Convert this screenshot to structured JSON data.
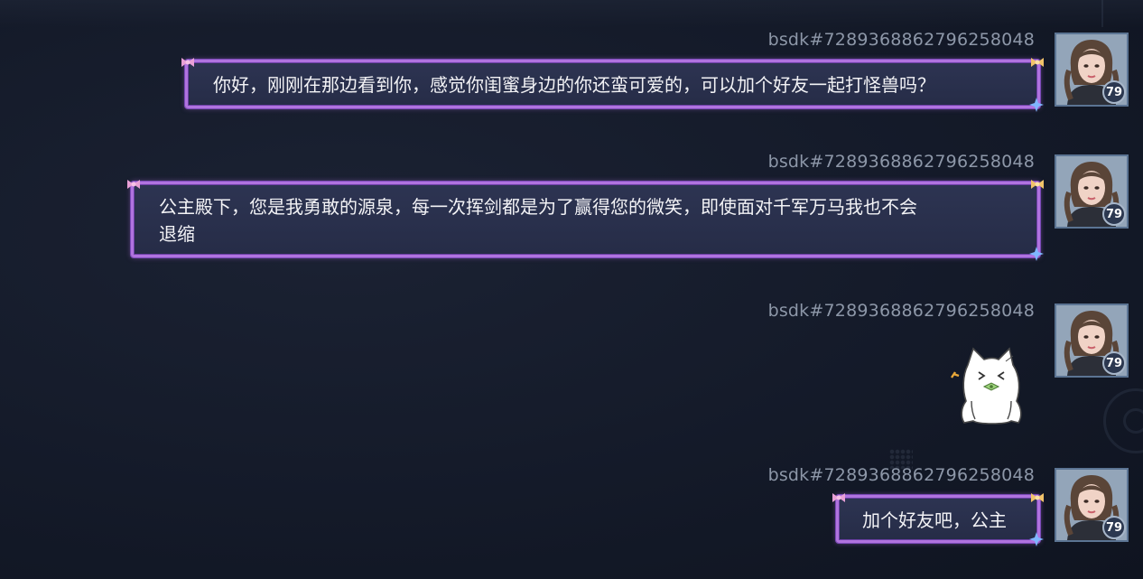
{
  "messages": [
    {
      "sender": "bsdk#7289368862796258048",
      "text": "你好，刚刚在那边看到你，感觉你闺蜜身边的你还蛮可爱的，可以加个好友一起打怪兽吗？",
      "level": "79"
    },
    {
      "sender": "bsdk#7289368862796258048",
      "text_line1": "公主殿下，您是我勇敢的源泉，每一次挥剑都是为了赢得您的微笑，即使面对千军万马我也不会",
      "text_line2": "退缩",
      "level": "79"
    },
    {
      "sender": "bsdk#7289368862796258048",
      "sticker": "cat-sticker",
      "level": "79"
    },
    {
      "sender": "bsdk#7289368862796258048",
      "text": "加个好友吧，公主",
      "level": "79"
    }
  ],
  "icons": {
    "avatar": "avatar-portrait-icon",
    "bubble_decor": "bow-icon",
    "bubble_corner": "sparkle-icon",
    "sticker": "cat-sticker-icon"
  },
  "colors": {
    "background": "#141a29",
    "bubble_bg": "#2a3150",
    "bubble_border": "#b073df",
    "sender_text": "#8d97a8",
    "message_text": "#f3f3f6"
  }
}
